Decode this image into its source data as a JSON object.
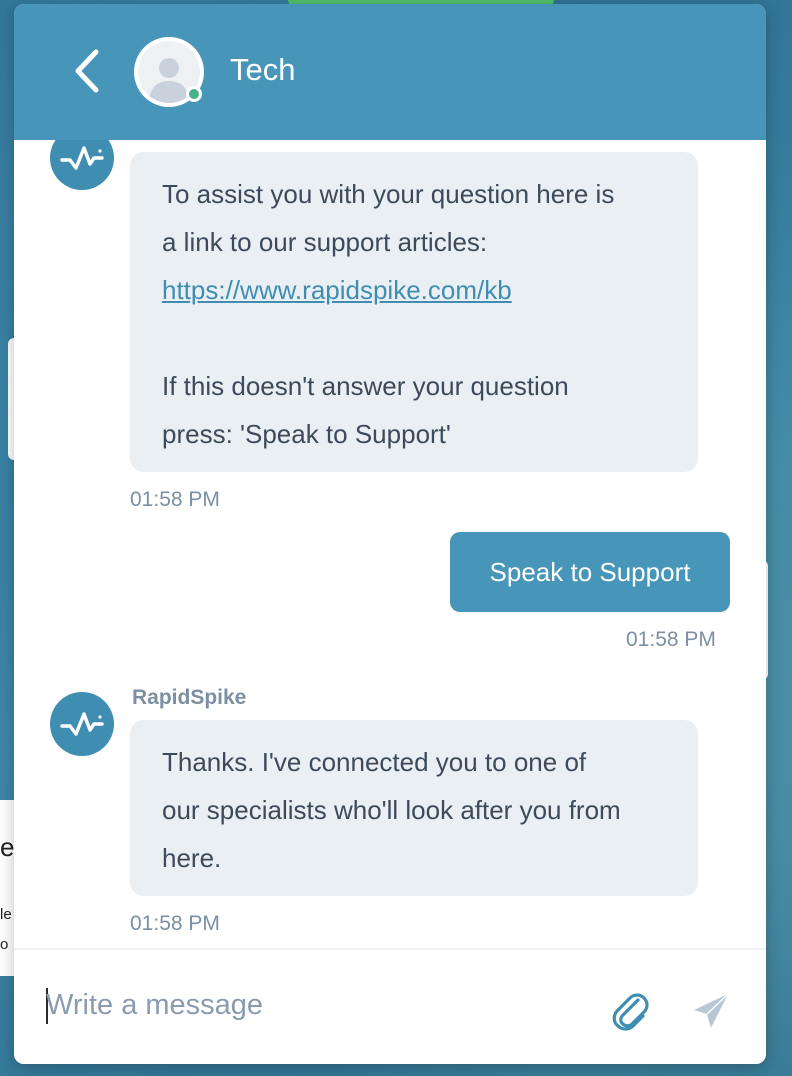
{
  "header": {
    "agent_name": "Tech",
    "status": "online"
  },
  "messages": [
    {
      "from": "bot",
      "lines": [
        "To assist you with your question here is",
        "a link to our support articles:",
        "",
        "",
        "If this doesn't answer your question",
        "press: 'Speak to Support'"
      ],
      "link": "https://www.rapidspike.com/kb",
      "time": "01:58 PM"
    },
    {
      "from": "user",
      "text": "Speak to Support",
      "time": "01:58 PM"
    },
    {
      "from": "bot",
      "sender": "RapidSpike",
      "lines": [
        "Thanks. I've connected you to one of",
        "our specialists who'll look after you from",
        "here."
      ],
      "time": "01:58 PM"
    }
  ],
  "composer": {
    "placeholder": "Write a message",
    "value": ""
  },
  "icons": {
    "back": "chevron-left-icon",
    "attach": "paperclip-icon",
    "send": "send-icon",
    "bot_logo": "rapidspike-logo-icon"
  },
  "colors": {
    "header": "#4796b9",
    "user_bubble": "#4796b9",
    "bot_bubble": "#eaeff4",
    "online": "#47b08d",
    "link": "#3f8eb2",
    "timestamp": "#7c8fa3"
  },
  "background": {
    "snippet_a": "e",
    "snippet_b": "le",
    "snippet_c": "o"
  }
}
